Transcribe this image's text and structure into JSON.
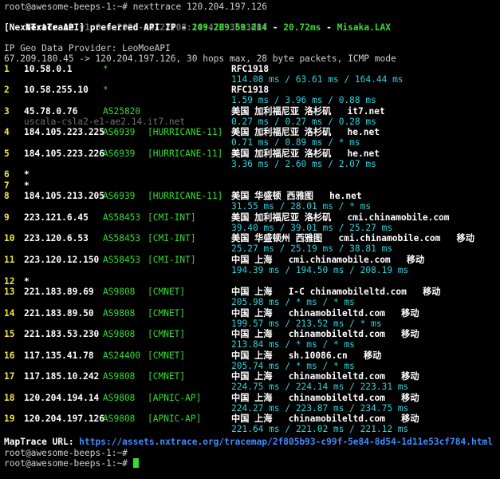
{
  "prompt_cmd": "root@awesome-beeps-1:~# nexttrace 120.204.197.126",
  "banner": {
    "name": "NextTrace",
    "version": "v1.6.4 2026-04-22T08:14:47Z 3ba3d0f"
  },
  "api": {
    "label": "[NextTrace API]",
    "text1": " preferred API IP - ",
    "ip": "209.209.59.214",
    "sep1": " - ",
    "latency": "20.72ms",
    "sep2": " - ",
    "node": "Misaka.LAX"
  },
  "provider": "IP Geo Data Provider: LeoMoeAPI",
  "route_info": "67.209.180.45 -> 120.204.197.126, 30 hops max, 28 byte packets, ICMP mode",
  "hops": [
    {
      "n": "1",
      "ip": "10.58.0.1",
      "asn": "*",
      "tag": "",
      "geo": "RFC1918",
      "rtt": "114.08 ms / 63.61 ms / 164.44 ms"
    },
    {
      "n": "2",
      "ip": "10.58.255.10",
      "asn": "*",
      "tag": "",
      "geo": "RFC1918",
      "rtt": "1.59 ms / 3.96 ms / 0.88 ms"
    },
    {
      "n": "3",
      "ip": "45.78.0.76",
      "asn": "AS25820",
      "tag": "",
      "geo": "美国 加利福尼亚 洛杉矶   it7.net",
      "rdns": "uscala-csla2-e1-ae2.14.it7.net",
      "rtt": "0.27 ms / 0.27 ms / 0.28 ms"
    },
    {
      "n": "4",
      "ip": "184.105.223.225",
      "asn": "AS6939",
      "tag": "[HURRICANE-11]",
      "geo": "美国 加利福尼亚 洛杉矶   he.net",
      "rtt": "0.71 ms / 0.89 ms / * ms"
    },
    {
      "n": "5",
      "ip": "184.105.223.226",
      "asn": "AS6939",
      "tag": "[HURRICANE-11]",
      "geo": "美国 加利福尼亚 洛杉矶   he.net",
      "rtt": "3.36 ms / 2.60 ms / 2.07 ms"
    },
    {
      "n": "6",
      "ip": "*"
    },
    {
      "n": "7",
      "ip": "*"
    },
    {
      "n": "8",
      "ip": "184.105.213.205",
      "asn": "AS6939",
      "tag": "[HURRICANE-11]",
      "geo": "美国 华盛顿 西雅图   he.net",
      "rtt": "31.55 ms / 28.01 ms / * ms"
    },
    {
      "n": "9",
      "ip": "223.121.6.45",
      "asn": "AS58453",
      "tag": "[CMI-INT]",
      "geo": "美国 加利福尼亚 洛杉矶   cmi.chinamobile.com",
      "rtt": "39.40 ms / 39.01 ms / 25.27 ms"
    },
    {
      "n": "10",
      "ip": "223.120.6.53",
      "asn": "AS58453",
      "tag": "[CMI-INT]",
      "geo": "美国 华盛顿州 西雅图   cmi.chinamobile.com   移动",
      "rtt": "25.27 ms / 25.19 ms / 38.81 ms"
    },
    {
      "n": "11",
      "ip": "223.120.12.150",
      "asn": "AS58453",
      "tag": "[CMI-INT]",
      "geo": "中国 上海   cmi.chinamobile.com   移动",
      "rtt": "194.39 ms / 194.50 ms / 208.19 ms"
    },
    {
      "n": "12",
      "ip": "*"
    },
    {
      "n": "13",
      "ip": "221.183.89.69",
      "asn": "AS9808",
      "tag": "[CMNET]",
      "geo": "中国 上海   I-C chinamobileltd.com   移动",
      "rtt": "205.98 ms / * ms / * ms"
    },
    {
      "n": "14",
      "ip": "221.183.89.50",
      "asn": "AS9808",
      "tag": "[CMNET]",
      "geo": "中国 上海   chinamobileltd.com   移动",
      "rtt": "199.57 ms / 213.52 ms / * ms"
    },
    {
      "n": "15",
      "ip": "221.183.53.230",
      "asn": "AS9808",
      "tag": "[CMNET]",
      "geo": "中国 上海   chinamobileltd.com   移动",
      "rtt": "213.84 ms / * ms / * ms"
    },
    {
      "n": "16",
      "ip": "117.135.41.78",
      "asn": "AS24400",
      "tag": "[CMNET]",
      "geo": "中国 上海   sh.10086.cn   移动",
      "rtt": "205.74 ms / * ms / * ms"
    },
    {
      "n": "17",
      "ip": "117.185.10.242",
      "asn": "AS9808",
      "tag": "[CMNET]",
      "geo": "中国 上海   chinamobileltd.com   移动",
      "rtt": "224.75 ms / 224.14 ms / 223.31 ms"
    },
    {
      "n": "18",
      "ip": "120.204.194.14",
      "asn": "AS9808",
      "tag": "[APNIC-AP]",
      "geo": "中国 上海   chinamobileltd.com   移动",
      "rtt": "224.27 ms / 223.87 ms / 234.75 ms"
    },
    {
      "n": "19",
      "ip": "120.204.197.126",
      "asn": "AS9808",
      "tag": "[APNIC-AP]",
      "geo": "中国 上海   chinamobileltd.com   移动",
      "rtt": "221.64 ms / 221.02 ms / 221.12 ms"
    }
  ],
  "maptrace": {
    "label": "MapTrace URL: ",
    "url": "https://assets.nxtrace.org/tracemap/2f805b93-c99f-5e84-8d54-1d11e53cf784.html"
  },
  "prompt1": "root@awesome-beeps-1:~#",
  "prompt2": "root@awesome-beeps-1:~# ",
  "colors": {
    "bg": "#000000",
    "green": "#33dd33",
    "yellow": "#f4e542",
    "cyan": "#2ad4e0",
    "blue": "#3f8cff",
    "gray": "#707070"
  }
}
